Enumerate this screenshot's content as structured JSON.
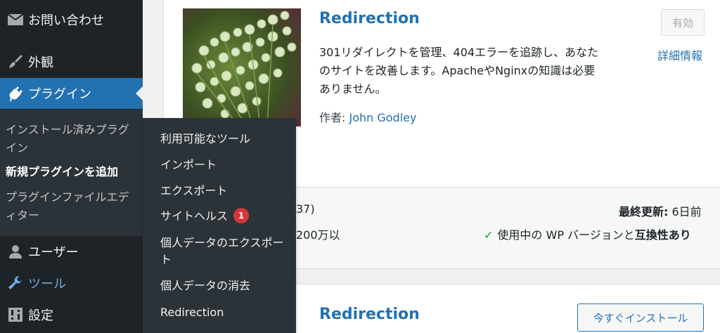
{
  "sidebar": {
    "items": {
      "contact": {
        "label": "お問い合わせ",
        "icon": "mail-icon"
      },
      "appearance": {
        "label": "外観",
        "icon": "paintbrush-icon"
      },
      "plugins": {
        "label": "プラグイン",
        "icon": "plugin-icon"
      },
      "users": {
        "label": "ユーザー",
        "icon": "user-icon"
      },
      "tools": {
        "label": "ツール",
        "icon": "wrench-icon"
      },
      "settings": {
        "label": "設定",
        "icon": "settings-icon"
      }
    },
    "plugins_submenu": {
      "installed": "インストール済みプラグイン",
      "add_new": "新規プラグインを追加",
      "editor": "プラグインファイルエディター"
    }
  },
  "tools_flyout": {
    "items": {
      "available_tools": "利用可能なツール",
      "import": "インポート",
      "export": "エクスポート",
      "site_health": "サイトヘルス",
      "site_health_badge": "1",
      "export_personal": "個人データのエクスポート",
      "erase_personal": "個人データの消去",
      "redirection": "Redirection"
    }
  },
  "plugin_card": {
    "name": "Redirection",
    "description": "301リダイレクトを管理、404エラーを追跡し、あなたのサイトを改善します。ApacheやNginxの知識は必要ありません。",
    "author_label": "作者: ",
    "author_name": "John Godley",
    "action_button": "有効",
    "more_details": "詳細情報",
    "rating_count_fragment": "37)",
    "installs_fragment": "200万以",
    "last_updated_label": "最終更新:",
    "last_updated_value": " 6日前",
    "compat_prefix": "使用中の WP バージョンと",
    "compat_strong": "互換性あり"
  },
  "second_card": {
    "name": "Redirection",
    "install_button": "今すぐインストール"
  },
  "colors": {
    "sidebar_bg": "#1d2327",
    "submenu_bg": "#2c3338",
    "accent_blue": "#2271b1",
    "badge_red": "#d63638",
    "check_green": "#00a32a"
  }
}
